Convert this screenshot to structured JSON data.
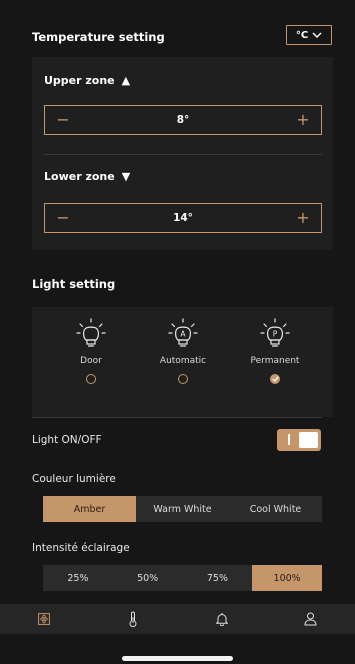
{
  "temperature": {
    "title": "Temperature setting",
    "unit": "°C",
    "upper": {
      "label": "Upper zone",
      "arrow": "▲",
      "value": "8°",
      "minus": "−",
      "plus": "+"
    },
    "lower": {
      "label": "Lower zone",
      "arrow": "▼",
      "value": "14°",
      "minus": "−",
      "plus": "+"
    }
  },
  "light": {
    "title": "Light setting",
    "modes": [
      {
        "label": "Door",
        "letter": "",
        "selected": false
      },
      {
        "label": "Automatic",
        "letter": "A",
        "selected": false
      },
      {
        "label": "Permanent",
        "letter": "P",
        "selected": true
      }
    ],
    "onoff_label": "Light ON/OFF",
    "toggle_on": true,
    "color_label": "Couleur lumière",
    "colors": [
      "Amber",
      "Warm White",
      "Cool White"
    ],
    "selected_color": "Amber",
    "intensity_label": "Intensité éclairage",
    "intensities": [
      "25%",
      "50%",
      "75%",
      "100%"
    ],
    "selected_intensity": "100%"
  },
  "nav": {
    "items": [
      "cellar-icon",
      "thermometer-icon",
      "bell-icon",
      "user-icon"
    ],
    "active": "cellar-icon"
  },
  "colors": {
    "accent": "#c5966a",
    "background": "#161616",
    "panel": "#1f1f1f"
  }
}
